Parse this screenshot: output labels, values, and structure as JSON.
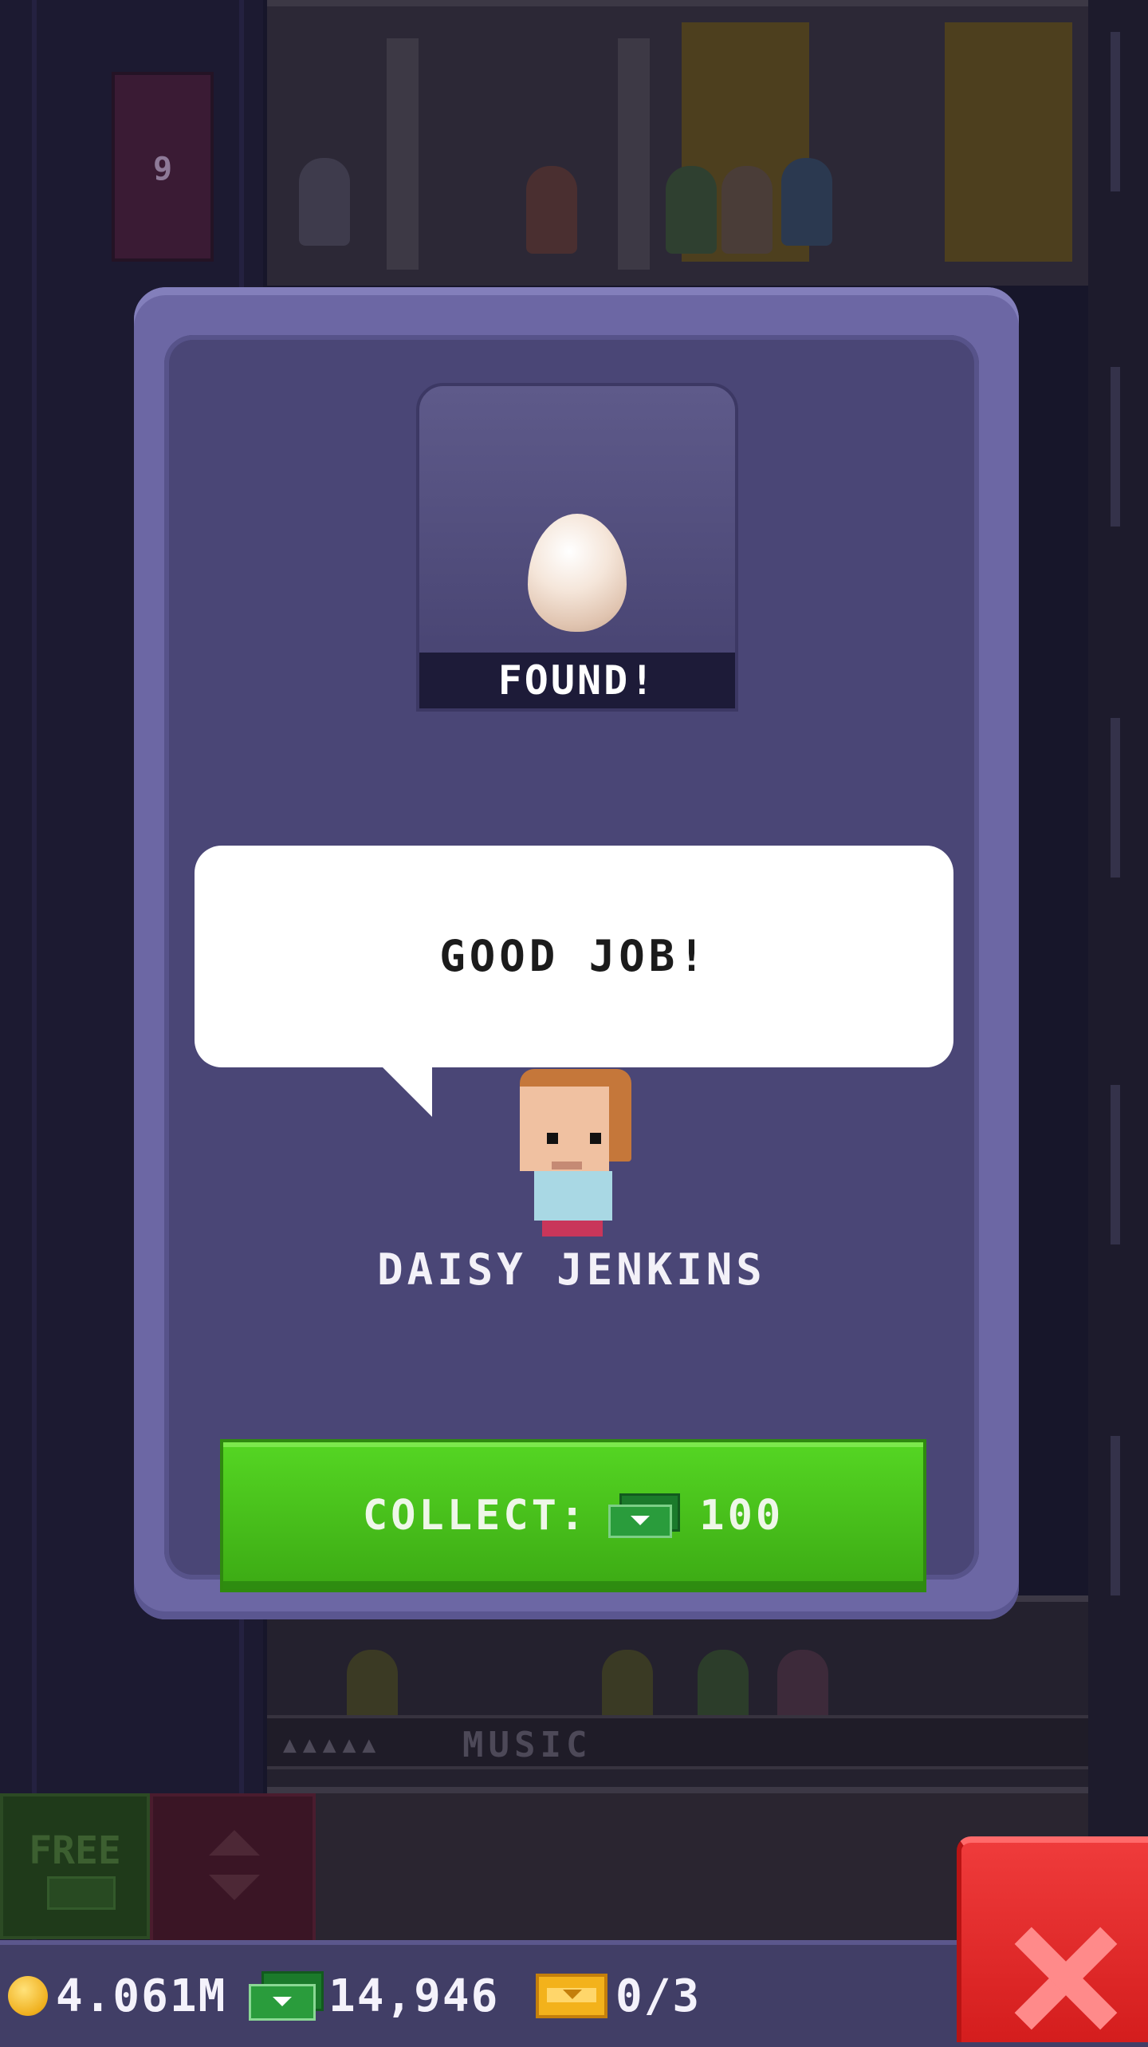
{
  "background": {
    "elevator_floor_number": "9",
    "music_floor_label": "MUSIC",
    "free_button_label": "FREE"
  },
  "modal": {
    "found_label": "FOUND!",
    "item_icon": "egg-icon",
    "speech_text": "GOOD JOB!",
    "npc_name": "DAISY JENKINS",
    "collect_label": "COLLECT:",
    "collect_amount": "100",
    "collect_currency_icon": "tower-bux-icon"
  },
  "status_bar": {
    "coins": "4.061M",
    "bux": "14,946",
    "tickets": "0/3"
  },
  "colors": {
    "modal_frame": "#6c67a4",
    "modal_inner": "#4a4676",
    "collect_button": "#4cc41d",
    "close_button": "#e02a2a"
  }
}
